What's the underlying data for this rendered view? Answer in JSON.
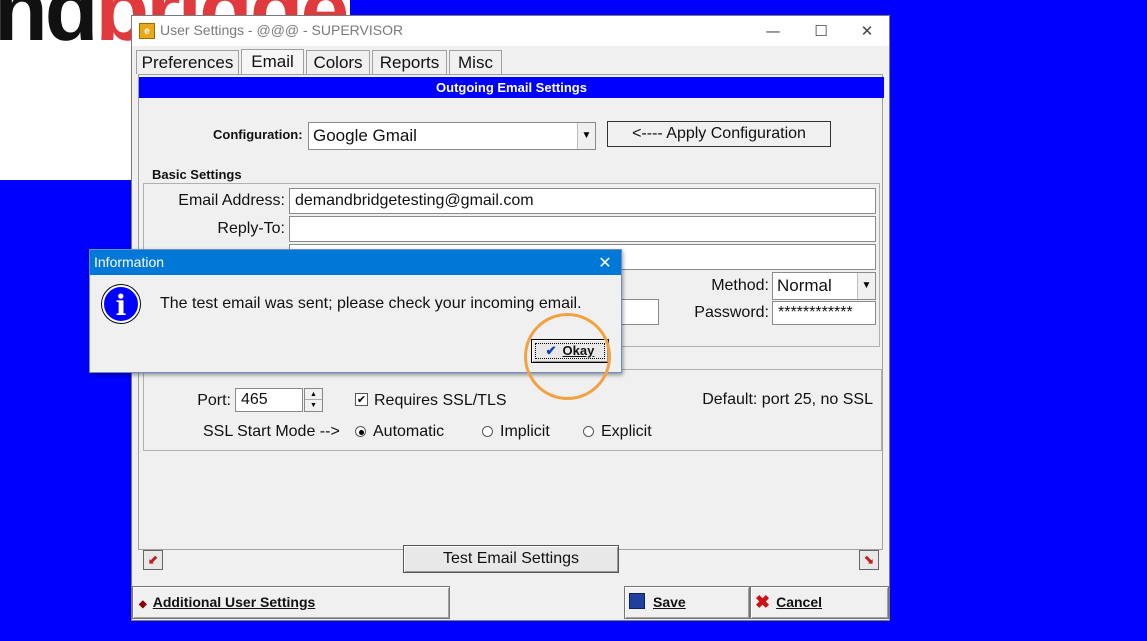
{
  "logo": {
    "dark": "nd",
    "red": "bridge"
  },
  "window": {
    "title": "User Settings - @@@ - SUPERVISOR",
    "icon": "e",
    "minimize": "—",
    "maximize": "☐",
    "close": "✕"
  },
  "tabs": [
    {
      "label": "Preferences"
    },
    {
      "label": "Email"
    },
    {
      "label": "Colors"
    },
    {
      "label": "Reports"
    },
    {
      "label": "Misc"
    }
  ],
  "email": {
    "section_title": "Outgoing Email Settings",
    "configuration_label": "Configuration:",
    "configuration_value": "Google Gmail",
    "apply_button": "<---- Apply Configuration",
    "basic_settings_title": "Basic Settings",
    "email_address_label": "Email Address:",
    "email_address_value": "demandbridgetesting@gmail.com",
    "reply_to_label": "Reply-To:",
    "reply_to_value": "",
    "extra_field_value": "",
    "method_label": "Method:",
    "method_value": "Normal",
    "password_label": "Password:",
    "password_value": "************",
    "port_label": "Port:",
    "port_value": "465",
    "requires_ssl_label": "Requires SSL/TLS",
    "requires_ssl_checked": true,
    "default_note": "Default: port 25, no SSL",
    "ssl_mode_label": "SSL Start Mode -->",
    "ssl_modes": [
      {
        "label": "Automatic",
        "selected": true
      },
      {
        "label": "Implicit",
        "selected": false
      },
      {
        "label": "Explicit",
        "selected": false
      }
    ],
    "test_button": "Test Email Settings"
  },
  "footer": {
    "additional_button": "Additional User Settings",
    "save_button": "Save",
    "cancel_button": "Cancel"
  },
  "dialog": {
    "title": "Information",
    "close": "✕",
    "icon_glyph": "i",
    "message": "The test email was sent; please check your incoming email.",
    "okay_check": "✔",
    "okay_button": "Okay"
  },
  "colors": {
    "accent_blue": "#0000ff",
    "dialog_title": "#0078d7",
    "highlight": "#f4a142"
  }
}
